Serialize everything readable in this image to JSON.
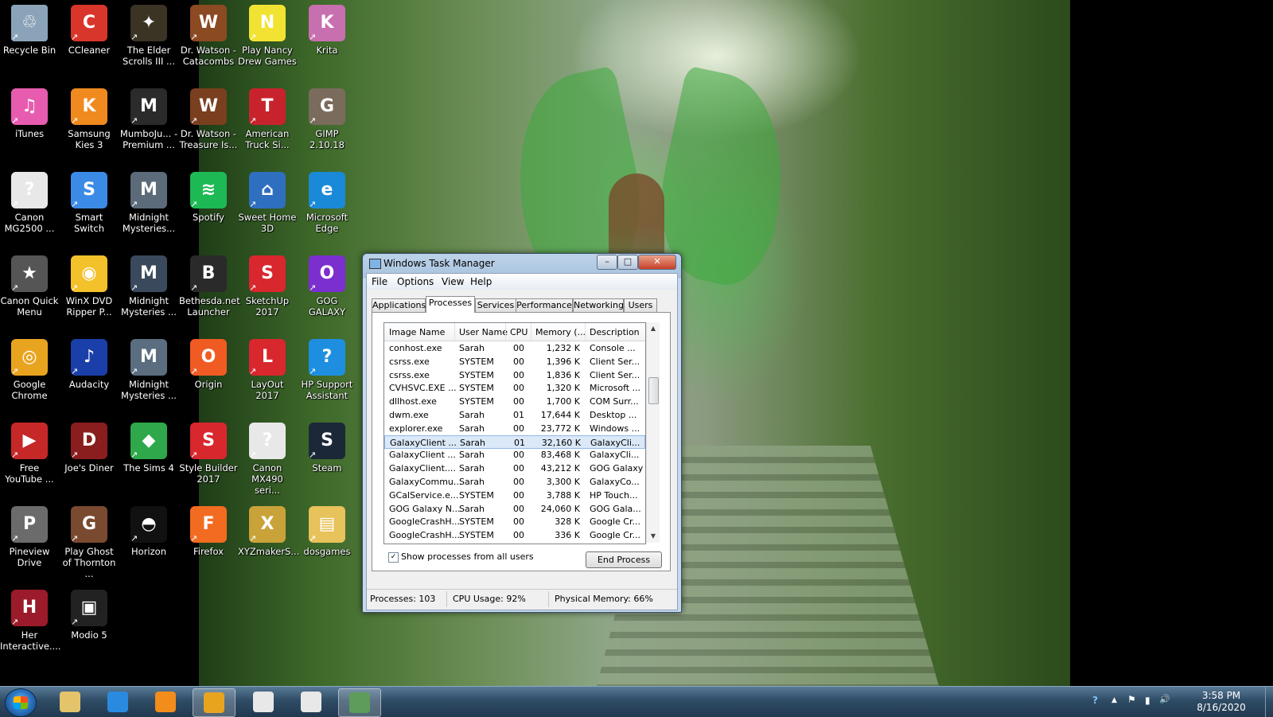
{
  "desktop": {
    "icons": [
      {
        "label": "Recycle Bin",
        "icon": "recycle-bin-icon",
        "color": "#8aa3b8",
        "glyph": "♲"
      },
      {
        "label": "CCleaner",
        "icon": "ccleaner-icon",
        "color": "#d9362b",
        "glyph": "C"
      },
      {
        "label": "The Elder Scrolls III ...",
        "icon": "elder-scrolls-icon",
        "color": "#3b3324",
        "glyph": "✦"
      },
      {
        "label": "Dr. Watson - Catacombs",
        "icon": "game-icon",
        "color": "#8b4a22",
        "glyph": "W"
      },
      {
        "label": "Play Nancy Drew Games",
        "icon": "nancy-drew-icon",
        "color": "#f2e332",
        "glyph": "N"
      },
      {
        "label": "Krita",
        "icon": "krita-icon",
        "color": "#c86fb0",
        "glyph": "K"
      },
      {
        "label": "iTunes",
        "icon": "itunes-icon",
        "color": "#e85cb0",
        "glyph": "♫"
      },
      {
        "label": "Samsung Kies 3",
        "icon": "kies-icon",
        "color": "#f08a1e",
        "glyph": "K"
      },
      {
        "label": "MumboJu... - Premium ...",
        "icon": "mumbojumbo-icon",
        "color": "#2b2b2b",
        "glyph": "M"
      },
      {
        "label": "Dr. Watson - Treasure Is...",
        "icon": "game-icon",
        "color": "#7a3f1e",
        "glyph": "W"
      },
      {
        "label": "American Truck Si...",
        "icon": "truck-icon",
        "color": "#c8232c",
        "glyph": "T"
      },
      {
        "label": "GIMP 2.10.18",
        "icon": "gimp-icon",
        "color": "#7a6b5c",
        "glyph": "G"
      },
      {
        "label": "Canon MG2500 ...",
        "icon": "printer-icon",
        "color": "#e8e8e8",
        "glyph": "?"
      },
      {
        "label": "Smart Switch",
        "icon": "smart-switch-icon",
        "color": "#3b8be6",
        "glyph": "S"
      },
      {
        "label": "Midnight Mysteries...",
        "icon": "raven-icon",
        "color": "#5c6b7a",
        "glyph": "M"
      },
      {
        "label": "Spotify",
        "icon": "spotify-icon",
        "color": "#1db954",
        "glyph": "≋"
      },
      {
        "label": "Sweet Home 3D",
        "icon": "house-icon",
        "color": "#2f6fbf",
        "glyph": "⌂"
      },
      {
        "label": "Microsoft Edge",
        "icon": "edge-icon",
        "color": "#1a8ad8",
        "glyph": "e"
      },
      {
        "label": "Canon Quick Menu",
        "icon": "quick-menu-icon",
        "color": "#555555",
        "glyph": "★"
      },
      {
        "label": "WinX DVD Ripper P...",
        "icon": "dvd-icon",
        "color": "#f3c12a",
        "glyph": "◉"
      },
      {
        "label": "Midnight Mysteries ...",
        "icon": "game-icon",
        "color": "#3a4a5c",
        "glyph": "M"
      },
      {
        "label": "Bethesda.net Launcher",
        "icon": "bethesda-icon",
        "color": "#2a2a2a",
        "glyph": "B"
      },
      {
        "label": "SketchUp 2017",
        "icon": "sketchup-icon",
        "color": "#d9272e",
        "glyph": "S"
      },
      {
        "label": "GOG GALAXY",
        "icon": "gog-galaxy-icon",
        "color": "#7b2fcf",
        "glyph": "O"
      },
      {
        "label": "Google Chrome",
        "icon": "chrome-icon",
        "color": "#e9a41f",
        "glyph": "◎"
      },
      {
        "label": "Audacity",
        "icon": "audacity-icon",
        "color": "#1b3fa8",
        "glyph": "♪"
      },
      {
        "label": "Midnight Mysteries ...",
        "icon": "ship-icon",
        "color": "#5a6e80",
        "glyph": "M"
      },
      {
        "label": "Origin",
        "icon": "origin-icon",
        "color": "#f05b23",
        "glyph": "O"
      },
      {
        "label": "LayOut 2017",
        "icon": "layout-icon",
        "color": "#d9272e",
        "glyph": "L"
      },
      {
        "label": "HP Support Assistant",
        "icon": "help-icon",
        "color": "#1e8fe0",
        "glyph": "?"
      },
      {
        "label": "Free YouTube ...",
        "icon": "youtube-icon",
        "color": "#c62828",
        "glyph": "▶"
      },
      {
        "label": "Joe's Diner",
        "icon": "diner-icon",
        "color": "#8a1d1d",
        "glyph": "D"
      },
      {
        "label": "The Sims 4",
        "icon": "sims-icon",
        "color": "#2ea84a",
        "glyph": "◆"
      },
      {
        "label": "Style Builder 2017",
        "icon": "style-builder-icon",
        "color": "#d9272e",
        "glyph": "S"
      },
      {
        "label": "Canon MX490 seri...",
        "icon": "printer-icon",
        "color": "#e8e8e8",
        "glyph": "?"
      },
      {
        "label": "Steam",
        "icon": "steam-icon",
        "color": "#1b2838",
        "glyph": "S"
      },
      {
        "label": "Pineview Drive",
        "icon": "house-icon",
        "color": "#6b6b6b",
        "glyph": "P"
      },
      {
        "label": "Play Ghost of Thornton ...",
        "icon": "ghost-icon",
        "color": "#7a4a30",
        "glyph": "G"
      },
      {
        "label": "Horizon",
        "icon": "horizon-icon",
        "color": "#111111",
        "glyph": "◓"
      },
      {
        "label": "Firefox",
        "icon": "firefox-icon",
        "color": "#f26b21",
        "glyph": "F"
      },
      {
        "label": "XYZmakerS...",
        "icon": "xyz-icon",
        "color": "#c9a23a",
        "glyph": "X"
      },
      {
        "label": "dosgames",
        "icon": "folder-icon",
        "color": "#e8c25a",
        "glyph": "▤"
      },
      {
        "label": "Her Interactive....",
        "icon": "her-interactive-icon",
        "color": "#9b1b2b",
        "glyph": "H"
      },
      {
        "label": "Modio 5",
        "icon": "cube-icon",
        "color": "#222222",
        "glyph": "▣"
      }
    ]
  },
  "taskmanager": {
    "title": "Windows Task Manager",
    "menu": [
      "File",
      "Options",
      "View",
      "Help"
    ],
    "tabs": [
      "Applications",
      "Processes",
      "Services",
      "Performance",
      "Networking",
      "Users"
    ],
    "active_tab": "Processes",
    "columns": [
      "Image Name",
      "User Name",
      "CPU",
      "Memory (...",
      "Description"
    ],
    "rows": [
      {
        "name": "conhost.exe",
        "user": "Sarah",
        "cpu": "00",
        "mem": "1,232 K",
        "desc": "Console ..."
      },
      {
        "name": "csrss.exe",
        "user": "SYSTEM",
        "cpu": "00",
        "mem": "1,396 K",
        "desc": "Client Ser..."
      },
      {
        "name": "csrss.exe",
        "user": "SYSTEM",
        "cpu": "00",
        "mem": "1,836 K",
        "desc": "Client Ser..."
      },
      {
        "name": "CVHSVC.EXE ...",
        "user": "SYSTEM",
        "cpu": "00",
        "mem": "1,320 K",
        "desc": "Microsoft ..."
      },
      {
        "name": "dllhost.exe",
        "user": "SYSTEM",
        "cpu": "00",
        "mem": "1,700 K",
        "desc": "COM Surr..."
      },
      {
        "name": "dwm.exe",
        "user": "Sarah",
        "cpu": "01",
        "mem": "17,644 K",
        "desc": "Desktop ..."
      },
      {
        "name": "explorer.exe",
        "user": "Sarah",
        "cpu": "00",
        "mem": "23,772 K",
        "desc": "Windows ..."
      },
      {
        "name": "GalaxyClient ...",
        "user": "Sarah",
        "cpu": "01",
        "mem": "32,160 K",
        "desc": "GalaxyCli..."
      },
      {
        "name": "GalaxyClient ...",
        "user": "Sarah",
        "cpu": "00",
        "mem": "83,468 K",
        "desc": "GalaxyCli..."
      },
      {
        "name": "GalaxyClient....",
        "user": "Sarah",
        "cpu": "00",
        "mem": "43,212 K",
        "desc": "GOG Galaxy"
      },
      {
        "name": "GalaxyCommu...",
        "user": "Sarah",
        "cpu": "00",
        "mem": "3,300 K",
        "desc": "GalaxyCo..."
      },
      {
        "name": "GCalService.e...",
        "user": "SYSTEM",
        "cpu": "00",
        "mem": "3,788 K",
        "desc": "HP Touch..."
      },
      {
        "name": "GOG Galaxy N...",
        "user": "Sarah",
        "cpu": "00",
        "mem": "24,060 K",
        "desc": "GOG Gala..."
      },
      {
        "name": "GoogleCrashH...",
        "user": "SYSTEM",
        "cpu": "00",
        "mem": "328 K",
        "desc": "Google Cr..."
      },
      {
        "name": "GoogleCrashH...",
        "user": "SYSTEM",
        "cpu": "00",
        "mem": "336 K",
        "desc": "Google Cr..."
      }
    ],
    "selected_row": 7,
    "show_all_label": "Show processes from all users",
    "show_all_checked": "✓",
    "end_process_label": "End Process",
    "status": {
      "processes": "Processes: 103",
      "cpu": "CPU Usage: 92%",
      "memory": "Physical Memory: 66%"
    },
    "window_buttons": {
      "minimize": "–",
      "maximize": "□",
      "close": "✕"
    }
  },
  "taskbar": {
    "pinned": [
      {
        "name": "explorer-icon",
        "color": "#e3c46a"
      },
      {
        "name": "internet-explorer-icon",
        "color": "#2a8ae0"
      },
      {
        "name": "media-player-icon",
        "color": "#f28c1b"
      },
      {
        "name": "chrome-icon",
        "color": "#e9a41f"
      },
      {
        "name": "notepad-icon",
        "color": "#e8e8e8"
      },
      {
        "name": "notepad-icon",
        "color": "#e8e8e8"
      },
      {
        "name": "task-manager-icon",
        "color": "#5e9c5a"
      }
    ],
    "active_index": 3,
    "active_index_2": 6,
    "tray_icons": {
      "help": "?",
      "arrow": "▲",
      "flag": "⚑",
      "network": "▮",
      "volume": "🔊"
    },
    "clock_time": "3:58 PM",
    "clock_date": "8/16/2020"
  }
}
